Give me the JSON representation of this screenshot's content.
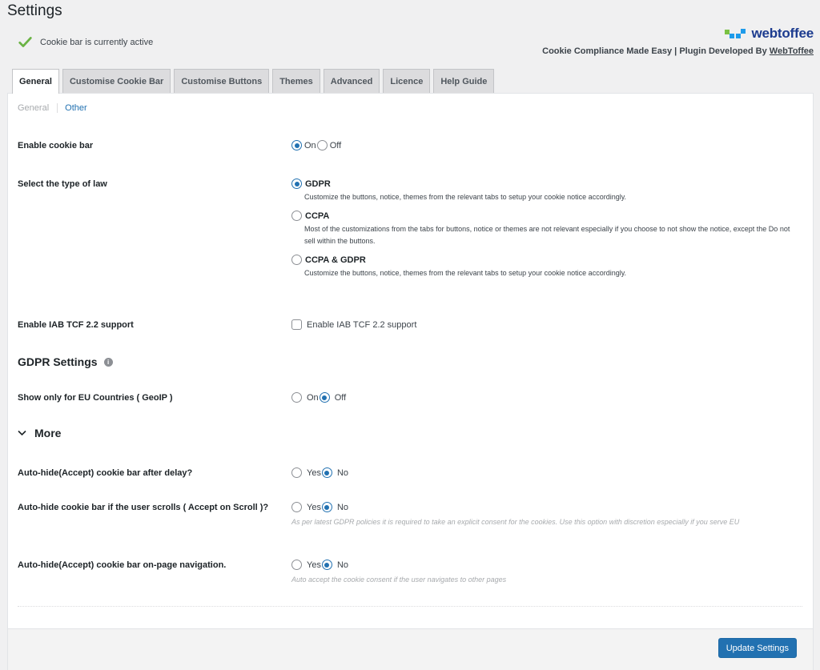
{
  "page": {
    "title": "Settings",
    "status_text": "Cookie bar is currently active"
  },
  "brand": {
    "logo_text": "webtoffee",
    "tagline_prefix": "Cookie Compliance Made Easy | Plugin Developed By ",
    "tagline_link": "WebToffee",
    "colors": {
      "green": "#7ac143",
      "blue": "#1e9bea",
      "text": "#1c3b8f"
    }
  },
  "tabs": [
    {
      "label": "General",
      "active": true
    },
    {
      "label": "Customise Cookie Bar",
      "active": false
    },
    {
      "label": "Customise Buttons",
      "active": false
    },
    {
      "label": "Themes",
      "active": false
    },
    {
      "label": "Advanced",
      "active": false
    },
    {
      "label": "Licence",
      "active": false
    },
    {
      "label": "Help Guide",
      "active": false
    }
  ],
  "subnav": {
    "current": "General",
    "other": "Other"
  },
  "settings": {
    "enable_cookie_bar": {
      "label": "Enable cookie bar",
      "options": [
        "On",
        "Off"
      ],
      "selected": "On"
    },
    "law_type": {
      "label": "Select the type of law",
      "selected": "GDPR",
      "options": [
        {
          "name": "GDPR",
          "description": "Customize the buttons, notice, themes from the relevant tabs to setup your cookie notice accordingly."
        },
        {
          "name": "CCPA",
          "description": "Most of the customizations from the tabs for buttons, notice or themes are not relevant especially if you choose to not show the notice, except the Do not sell within the buttons."
        },
        {
          "name": "CCPA & GDPR",
          "description": "Customize the buttons, notice, themes from the relevant tabs to setup your cookie notice accordingly."
        }
      ]
    },
    "iab_tcf": {
      "label": "Enable IAB TCF 2.2 support",
      "checkbox_label": "Enable IAB TCF 2.2 support",
      "checked": false
    },
    "gdpr_heading": "GDPR Settings",
    "eu_only": {
      "label": "Show only for EU Countries ( GeoIP )",
      "options": [
        "On",
        "Off"
      ],
      "selected": "Off"
    },
    "more_label": "More",
    "auto_hide_delay": {
      "label": "Auto-hide(Accept) cookie bar after delay?",
      "options": [
        "Yes",
        "No"
      ],
      "selected": "No"
    },
    "auto_hide_scroll": {
      "label": "Auto-hide cookie bar if the user scrolls ( Accept on Scroll )?",
      "options": [
        "Yes",
        "No"
      ],
      "selected": "No",
      "note": "As per latest GDPR policies it is required to take an explicit consent for the cookies. Use this option with discretion especially if you serve EU"
    },
    "auto_hide_navigation": {
      "label": "Auto-hide(Accept) cookie bar on-page navigation.",
      "options": [
        "Yes",
        "No"
      ],
      "selected": "No",
      "note": "Auto accept the cookie consent if the user navigates to other pages"
    }
  },
  "footer": {
    "update_button": "Update Settings"
  }
}
